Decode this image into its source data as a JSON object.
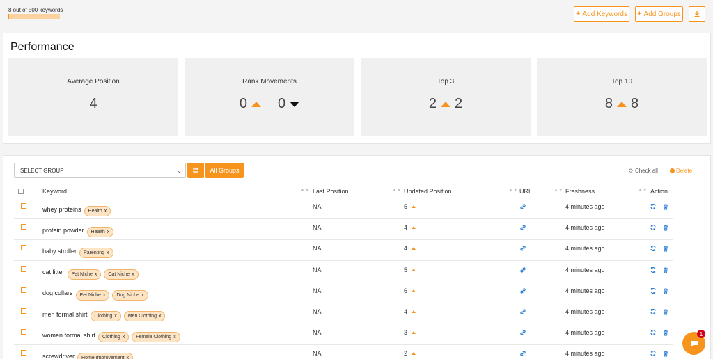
{
  "header": {
    "quota_text": "8 out of 500 keywords",
    "quota_fraction": 0.016,
    "add_keywords_label": "Add Keywords",
    "add_groups_label": "Add Groups",
    "download_icon": "download-icon"
  },
  "performance": {
    "title": "Performance",
    "average_position": {
      "label": "Average Position",
      "value": "4"
    },
    "rank_movements": {
      "label": "Rank Movements",
      "up": "0",
      "down": "0"
    },
    "top3": {
      "label": "Top 3",
      "prev": "2",
      "curr": "2"
    },
    "top10": {
      "label": "Top 10",
      "prev": "8",
      "curr": "8"
    }
  },
  "toolbar": {
    "select_placeholder": "SELECT GROUP",
    "all_groups_label": "All Groups",
    "check_all_label": "Check all",
    "delete_label": "Delete"
  },
  "table": {
    "columns": [
      "Keyword",
      "Last Position",
      "Updated Position",
      "URL",
      "Freshness",
      "Action"
    ],
    "rows": [
      {
        "keyword": "whey proteins",
        "tags": [
          "Health"
        ],
        "last": "NA",
        "updated": "5",
        "freshness": "4 minutes ago"
      },
      {
        "keyword": "protein powder",
        "tags": [
          "Health"
        ],
        "last": "NA",
        "updated": "4",
        "freshness": "4 minutes ago"
      },
      {
        "keyword": "baby stroller",
        "tags": [
          "Parenting"
        ],
        "last": "NA",
        "updated": "4",
        "freshness": "4 minutes ago"
      },
      {
        "keyword": "cat litter",
        "tags": [
          "Pet Niche",
          "Cat Niche"
        ],
        "last": "NA",
        "updated": "5",
        "freshness": "4 minutes ago"
      },
      {
        "keyword": "dog collars",
        "tags": [
          "Pet Niche",
          "Dog Niche"
        ],
        "last": "NA",
        "updated": "6",
        "freshness": "4 minutes ago"
      },
      {
        "keyword": "men formal shirt",
        "tags": [
          "Clothing",
          "Men Clothing"
        ],
        "last": "NA",
        "updated": "4",
        "freshness": "4 minutes ago"
      },
      {
        "keyword": "women formal shirt",
        "tags": [
          "Clothing",
          "Female Clothing"
        ],
        "last": "NA",
        "updated": "3",
        "freshness": "4 minutes ago"
      },
      {
        "keyword": "screwdriver",
        "tags": [
          "Home Improvement"
        ],
        "last": "NA",
        "updated": "2",
        "freshness": "4 minutes ago"
      }
    ]
  },
  "chat": {
    "badge": "1"
  },
  "colors": {
    "accent": "#f7941d",
    "link_blue": "#2a7fd4"
  }
}
